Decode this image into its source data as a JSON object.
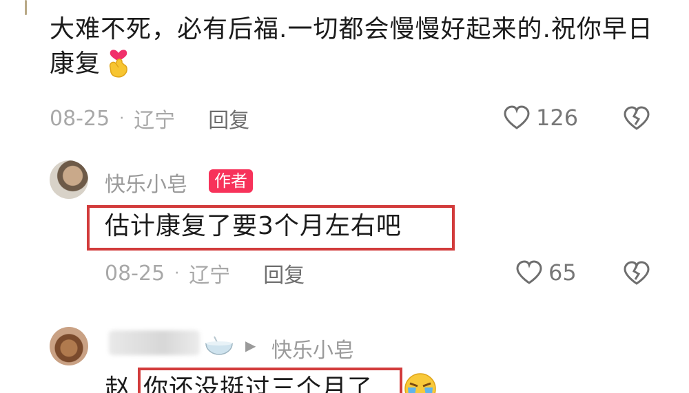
{
  "top_comment": {
    "text": "大难不死，必有后福.一切都会慢慢好起来的.祝你早日康复",
    "emoji": "finger-heart-icon",
    "date": "08-25",
    "separator": "·",
    "location": "辽宁",
    "reply_label": "回复",
    "likes": "126"
  },
  "author_reply": {
    "username": "快乐小皂",
    "badge": "作者",
    "text": "估计康复了要3个月左右吧",
    "date": "08-25",
    "separator": "·",
    "location": "辽宁",
    "reply_label": "回复",
    "likes": "65"
  },
  "sub_reply": {
    "username_icon": "bowl-icon",
    "arrow": "▶",
    "reply_to": "快乐小皂",
    "prefix": "赵",
    "text": "你还没挺过三个月了",
    "emoji": "crying-face-icon"
  },
  "colors": {
    "highlight_border": "#d23b3b",
    "author_badge": "#f7325a",
    "meta_text": "#a8a8a8"
  }
}
